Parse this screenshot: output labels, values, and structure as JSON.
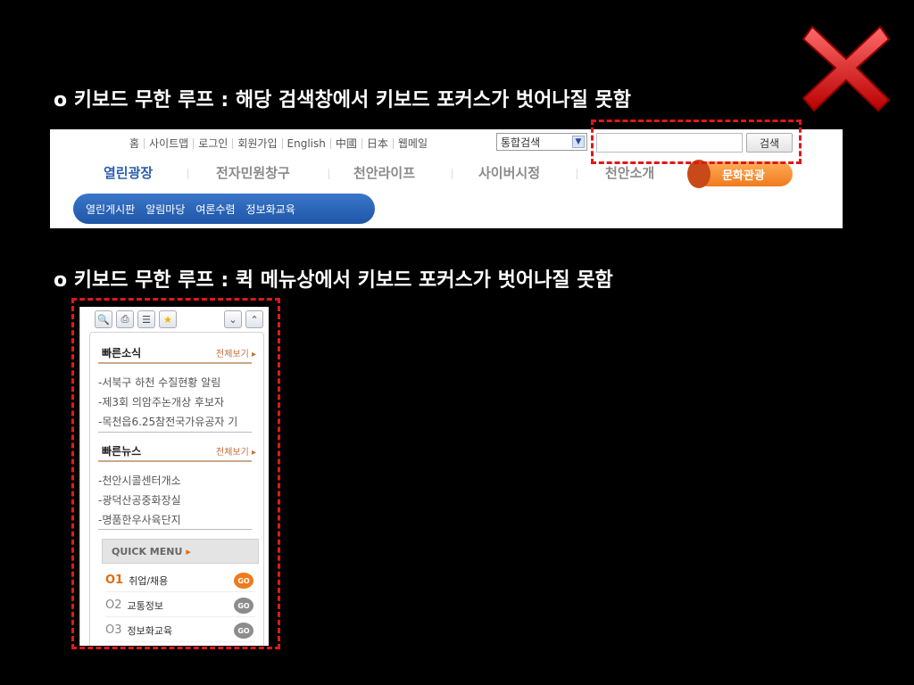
{
  "captions": {
    "search_loop": "o 키보드 무한 루프 : 해당 검색창에서 키보드 포커스가 벗어나질 못함",
    "quickmenu_loop": "o 키보드 무한 루프 : 퀵 메뉴상에서 키보드 포커스가 벗어나질 못함"
  },
  "error_mark_icon": "x-icon",
  "colors": {
    "focus_highlight": "#e01818",
    "accent_orange": "#f07a1c",
    "accent_blue": "#2a5db0"
  },
  "header": {
    "util_links": [
      "홈",
      "사이트맵",
      "로그인",
      "회원가입",
      "English",
      "中國",
      "日本",
      "웹메일"
    ],
    "search_select_value": "통합검색",
    "search_input_value": "",
    "search_button": "검색",
    "main_nav": [
      "열린광장",
      "전자민원창구",
      "천안라이프",
      "사이버시정",
      "천안소개"
    ],
    "culture_button": "문화관광",
    "sub_nav": [
      "열린게시판",
      "알림마당",
      "여론수렴",
      "정보화교육"
    ]
  },
  "quick": {
    "toolbar_icons": [
      "zoom-icon",
      "print-icon",
      "document-icon",
      "star-icon"
    ],
    "news": {
      "title": "빠른소식",
      "more": "전체보기",
      "items": [
        "서북구 하천 수질현황 알림",
        "제3회 의암주논개상 후보자",
        "목천읍6.25참전국가유공자 기"
      ]
    },
    "fastnews": {
      "title": "빠른뉴스",
      "more": "전체보기",
      "items": [
        "천안시콜센터개소",
        "광덕산공중화장실",
        "명품한우사육단지"
      ]
    },
    "quickmenu_title": "QUICK MENU",
    "menu": [
      {
        "num": "O1",
        "label": "취업/채용",
        "go": "GO"
      },
      {
        "num": "O2",
        "label": "교통정보",
        "go": "GO"
      },
      {
        "num": "O3",
        "label": "정보화교육",
        "go": "GO"
      }
    ]
  }
}
